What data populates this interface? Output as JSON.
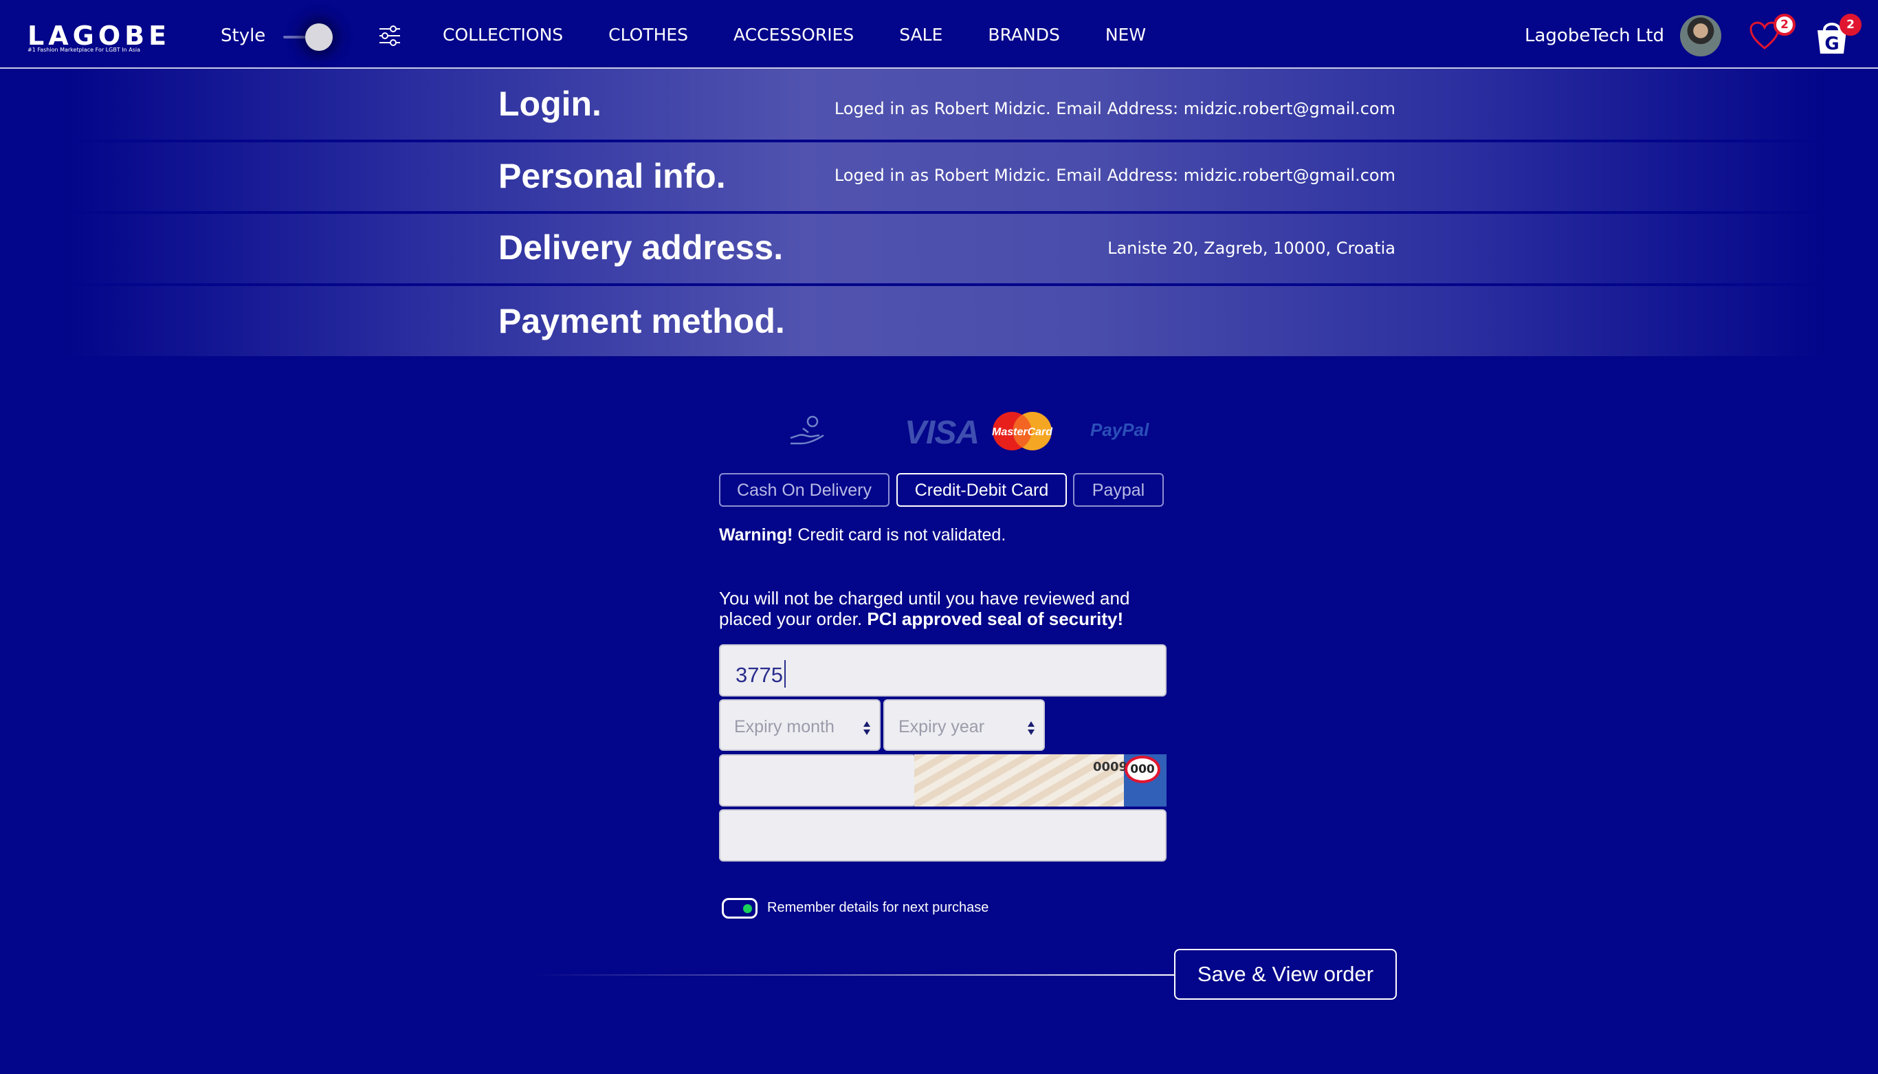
{
  "header": {
    "logo_text": "LAGOBE",
    "logo_tagline": "#1 Fashion Marketplace For LGBT In Asia",
    "style_label": "Style",
    "nav": [
      "COLLECTIONS",
      "CLOTHES",
      "ACCESSORIES",
      "SALE",
      "BRANDS",
      "NEW"
    ],
    "company": "LagobeTech Ltd",
    "wishlist_count": "2",
    "cart_count": "2"
  },
  "steps": {
    "login": {
      "title": "Login.",
      "info": "Loged in as Robert Midzic. Email Address:  midzic.robert@gmail.com"
    },
    "personal": {
      "title": "Personal info.",
      "info": "Loged in as Robert Midzic. Email Address:  midzic.robert@gmail.com"
    },
    "delivery": {
      "title": "Delivery address.",
      "info": "Laniste 20, Zagreb, 10000, Croatia"
    },
    "payment": {
      "title": "Payment method."
    }
  },
  "payment": {
    "logos": {
      "visa": "VISA",
      "mastercard": "MasterCard",
      "paypal": "PayPal"
    },
    "methods": [
      "Cash On Delivery",
      "Credit-Debit Card",
      "Paypal"
    ],
    "selected_method": "Credit-Debit Card",
    "warning_bold": "Warning!",
    "warning_text": " Credit card is not validated.",
    "notice_text": "You will not be charged until you have reviewed and placed your order. ",
    "notice_bold": "PCI approved seal of security!",
    "card_number_value": "3775",
    "expiry_month_placeholder": "Expiry month",
    "expiry_year_placeholder": "Expiry year",
    "cvc_sample_number": "0009",
    "cvc_sample_code": "000",
    "remember_label": "Remember details for next purchase",
    "remember_enabled": true,
    "save_button": "Save & View order"
  },
  "colors": {
    "background": "#03058a",
    "accent_red": "#e01530",
    "toggle_on": "#19d05a"
  }
}
